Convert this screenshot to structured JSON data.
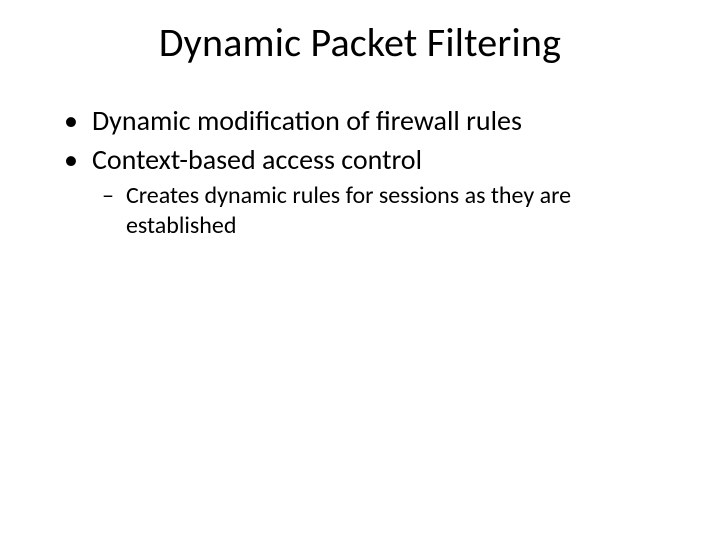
{
  "slide": {
    "title": "Dynamic Packet Filtering",
    "bullets": [
      {
        "marker": "•",
        "text": "Dynamic modification of firewall rules"
      },
      {
        "marker": "•",
        "text": "Context-based access control",
        "children": [
          {
            "marker": "–",
            "text": "Creates dynamic rules for sessions as they are established"
          }
        ]
      }
    ]
  }
}
